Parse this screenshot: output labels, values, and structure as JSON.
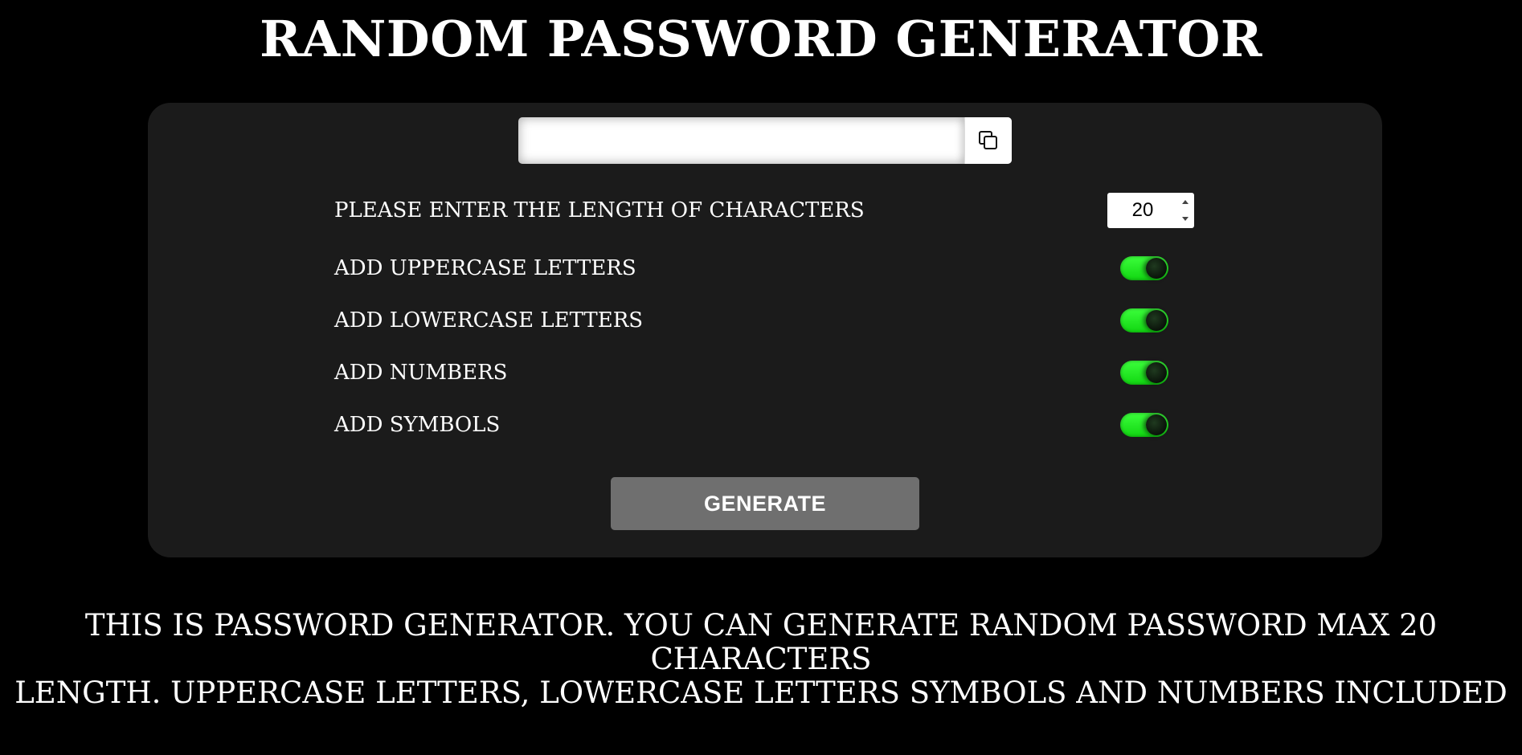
{
  "page": {
    "title": "RANDOM PASSWORD GENERATOR"
  },
  "password": {
    "value": "",
    "placeholder": ""
  },
  "copy": {
    "icon": "copy-icon"
  },
  "options": {
    "length_label": "PLEASE ENTER THE LENGTH OF CHARACTERS",
    "length_value": "20",
    "toggles": [
      {
        "label": "ADD UPPERCASE LETTERS",
        "checked": true
      },
      {
        "label": "ADD LOWERCASE LETTERS",
        "checked": true
      },
      {
        "label": "ADD NUMBERS",
        "checked": true
      },
      {
        "label": "ADD SYMBOLS",
        "checked": true
      }
    ]
  },
  "actions": {
    "generate_label": "GENERATE"
  },
  "description": {
    "line1": "THIS IS PASSWORD GENERATOR. YOU CAN GENERATE RANDOM PASSWORD MAX 20 CHARACTERS",
    "line2": "LENGTH. UPPERCASE LETTERS, LOWERCASE LETTERS SYMBOLS AND NUMBERS INCLUDED"
  },
  "colors": {
    "background": "#000000",
    "panel": "#1b1b1b",
    "toggle_on": "#22ee22",
    "button": "#6f6f6f"
  }
}
